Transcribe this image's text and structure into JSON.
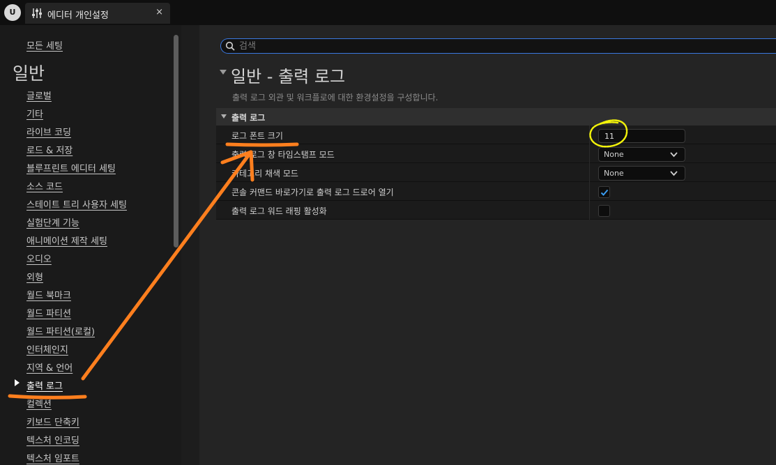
{
  "window": {
    "logo_text": "U",
    "tab_title": "에디터 개인설정",
    "tab_close": "×"
  },
  "sidebar": {
    "all_settings": "모든 세팅",
    "section_title": "일반",
    "items": [
      {
        "label": "글로벌"
      },
      {
        "label": "기타"
      },
      {
        "label": "라이브 코딩"
      },
      {
        "label": "로드 & 저장"
      },
      {
        "label": "블루프린트 에디터 세팅"
      },
      {
        "label": "소스 코드"
      },
      {
        "label": "스테이트 트리 사용자 세팅"
      },
      {
        "label": "실험단계 기능"
      },
      {
        "label": "애니메이션 제작 세팅"
      },
      {
        "label": "오디오"
      },
      {
        "label": "외형"
      },
      {
        "label": "월드 북마크"
      },
      {
        "label": "월드 파티션"
      },
      {
        "label": "월드 파티션(로컬)"
      },
      {
        "label": "인터체인지"
      },
      {
        "label": "지역 & 언어"
      },
      {
        "label": "출력 로그",
        "active": true
      },
      {
        "label": "컬렉션"
      },
      {
        "label": "키보드 단축키"
      },
      {
        "label": "텍스처 인코딩"
      },
      {
        "label": "텍스처 임포트"
      }
    ]
  },
  "search": {
    "placeholder": "검색",
    "value": ""
  },
  "page": {
    "title": "일반 - 출력 로그",
    "description": "출력 로그 외관 및 워크플로에 대한 환경설정을 구성합니다."
  },
  "category": {
    "title": "출력 로그",
    "rows": [
      {
        "label": "로그 폰트 크기",
        "control": "number",
        "value": "11"
      },
      {
        "label": "출력 로그 창 타임스탬프 모드",
        "control": "dropdown",
        "value": "None"
      },
      {
        "label": "카테고리 채색 모드",
        "control": "dropdown",
        "value": "None"
      },
      {
        "label": "콘솔 커맨드 바로가기로 출력 로그 드로어 열기",
        "control": "checkbox",
        "checked": true
      },
      {
        "label": "출력 로그 워드 래핑 활성화",
        "control": "checkbox",
        "checked": false
      }
    ]
  },
  "colors": {
    "accent": "#3a78e0",
    "annotation_orange": "#ff7f1e",
    "annotation_yellow": "#f2f20a"
  }
}
